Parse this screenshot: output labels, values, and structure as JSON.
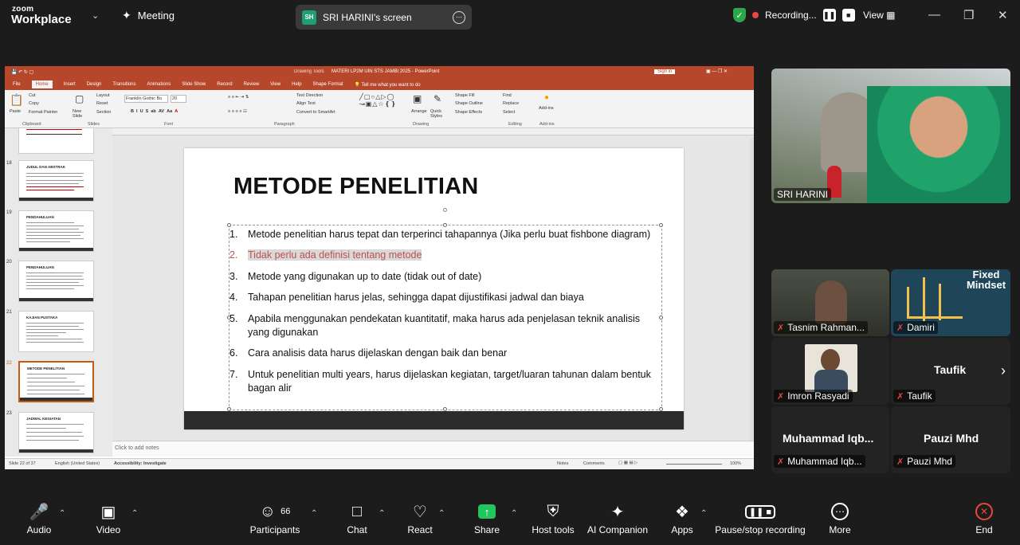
{
  "topbar": {
    "brand_top": "zoom",
    "brand_bottom": "Workplace",
    "meeting_label": "Meeting",
    "screen_initials": "SH",
    "screen_label": "SRI HARINI's screen",
    "recording_label": "Recording...",
    "view_label": "View"
  },
  "ppt": {
    "title_bar": "MATERI LP2M UIN STS JAMBI 2025 - PowerPoint",
    "drawing_tools": "Drawing Tools",
    "sign_in": "Sign in",
    "menu": [
      "File",
      "Home",
      "Insert",
      "Design",
      "Transitions",
      "Animations",
      "Slide Show",
      "Record",
      "Review",
      "View",
      "Help",
      "Shape Format"
    ],
    "tell_me": "Tell me what you want to do",
    "ribbon_groups": [
      "Clipboard",
      "Slides",
      "Font",
      "Paragraph",
      "Drawing",
      "Editing",
      "Add-ins"
    ],
    "ribbon_items": {
      "paste": "Paste",
      "cut": "Cut",
      "copy": "Copy",
      "format_painter": "Format Painter",
      "new_slide": "New Slide",
      "layout": "Layout",
      "reset": "Reset",
      "section": "Section",
      "font": "Franklin Gothic Bo",
      "size": "20",
      "text_direction": "Text Direction",
      "align_text": "Align Text",
      "convert": "Convert to SmartArt",
      "arrange": "Arrange",
      "quick_styles": "Quick Styles",
      "shape_fill": "Shape Fill",
      "shape_outline": "Shape Outline",
      "shape_effects": "Shape Effects",
      "find": "Find",
      "replace": "Replace",
      "select": "Select",
      "add_ins": "Add-ins"
    },
    "thumbs": [
      {
        "num": "18",
        "title": "JUDUL DAN ABSTRAK"
      },
      {
        "num": "19",
        "title": "PENDAHULUAN"
      },
      {
        "num": "20",
        "title": "PENDAHULUAN"
      },
      {
        "num": "21",
        "title": "KAJIAN PUSTAKA"
      },
      {
        "num": "22",
        "title": "METODE PENELITIAN"
      },
      {
        "num": "23",
        "title": "JADWAL KEGIATAN"
      }
    ],
    "slide_title": "METODE PENELITIAN",
    "bullets": [
      {
        "n": "1.",
        "text": "Metode penelitian harus tepat dan terperinci tahapannya (Jika perlu buat fishbone diagram)"
      },
      {
        "n": "2.",
        "text": "Tidak perlu ada definisi tentang metode"
      },
      {
        "n": "3.",
        "text": "Metode yang digunakan up to date (tidak out of date)"
      },
      {
        "n": "4.",
        "text": "Tahapan penelitian harus jelas, sehingga dapat dijustifikasi jadwal dan biaya"
      },
      {
        "n": "5.",
        "text": "Apabila menggunakan pendekatan kuantitatif, maka harus ada penjelasan teknik analisis yang digunakan"
      },
      {
        "n": "6.",
        "text": "Cara analisis data harus dijelaskan dengan baik dan benar"
      },
      {
        "n": "7.",
        "text": "Untuk penelitian multi years, harus dijelaskan kegiatan, target/luaran tahunan dalam bentuk bagan alir"
      }
    ],
    "notes": "Click to add notes",
    "status": {
      "slide": "Slide 22 of 37",
      "lang": "English (United States)",
      "access": "Accessibility: Investigate",
      "notes": "Notes",
      "comments": "Comments",
      "zoom": "100%"
    }
  },
  "participants": [
    {
      "name": "SRI HARINI"
    },
    {
      "name": "Tasnim Rahman..."
    },
    {
      "name": "Damiri",
      "bg_text": "Fixed Mindset"
    },
    {
      "name": "Imron Rasyadi"
    },
    {
      "name": "Taufik",
      "big": "Taufik"
    },
    {
      "name": "Muhammad Iqb...",
      "big": "Muhammad Iqb..."
    },
    {
      "name": "Pauzi Mhd",
      "big": "Pauzi Mhd"
    }
  ],
  "toolbar": {
    "audio": "Audio",
    "video": "Video",
    "participants": "Participants",
    "participants_count": "66",
    "chat": "Chat",
    "react": "React",
    "share": "Share",
    "host_tools": "Host tools",
    "ai": "AI Companion",
    "apps": "Apps",
    "pause_rec": "Pause/stop recording",
    "more": "More",
    "end": "End"
  }
}
